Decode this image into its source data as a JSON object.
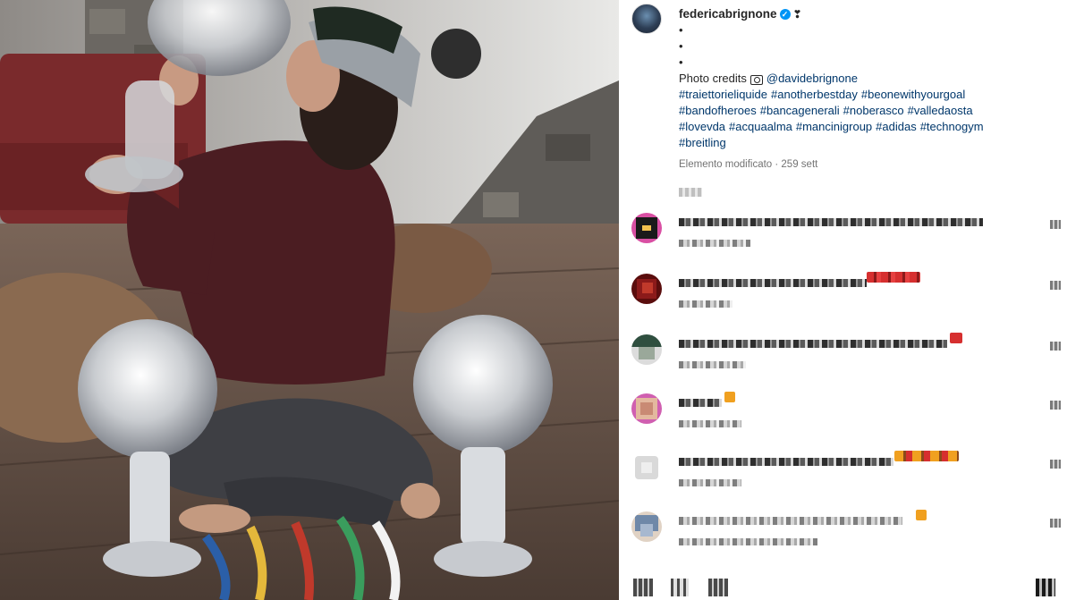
{
  "post": {
    "username": "federicabrignone",
    "verified_mark": "✓",
    "username_emoji": "❣",
    "dots": [
      "•",
      "•",
      "•"
    ],
    "credits_prefix": "Photo credits",
    "credits_mention": "@davidebrignone",
    "hashtags": [
      "#traiettorieliquide",
      "#anotherbestday",
      "#beonewithyourgoal",
      "#bandofheroes",
      "#bancagenerali",
      "#noberasco",
      "#valledaosta",
      "#lovevda",
      "#acquaalma",
      "#mancinigroup",
      "#adidas",
      "#technogym",
      "#breitling"
    ],
    "meta": "Elemento modificato · 259 sett"
  },
  "icons": {
    "verified": "verified-badge-icon",
    "camera": "camera-emoji-icon",
    "like": "heart-icon"
  },
  "colors": {
    "link": "#00376b",
    "verified": "#0095f6",
    "meta": "#737373"
  },
  "comments": [
    {
      "avatar_colors": [
        "#1a1a1a",
        "#d94fa3",
        "#f2c14e"
      ],
      "accent": "#888888"
    },
    {
      "avatar_colors": [
        "#8b1a1a",
        "#c0392b",
        "#5a0d0d"
      ],
      "accent": "#d62f2f"
    },
    {
      "avatar_colors": [
        "#2f4f3f",
        "#9aa89a",
        "#dcdcdc"
      ],
      "accent": "#d62f2f"
    },
    {
      "avatar_colors": [
        "#c98a74",
        "#e3b89e",
        "#d05fb0"
      ],
      "accent": "#f0a020"
    },
    {
      "avatar_colors": [
        "#d9d9d9",
        "#bdbdbd",
        "#eeeeee"
      ],
      "accent": "#f0a020"
    },
    {
      "avatar_colors": [
        "#6f88a8",
        "#a7b8cf",
        "#e0d2c4"
      ],
      "accent": "#f0a020"
    }
  ]
}
